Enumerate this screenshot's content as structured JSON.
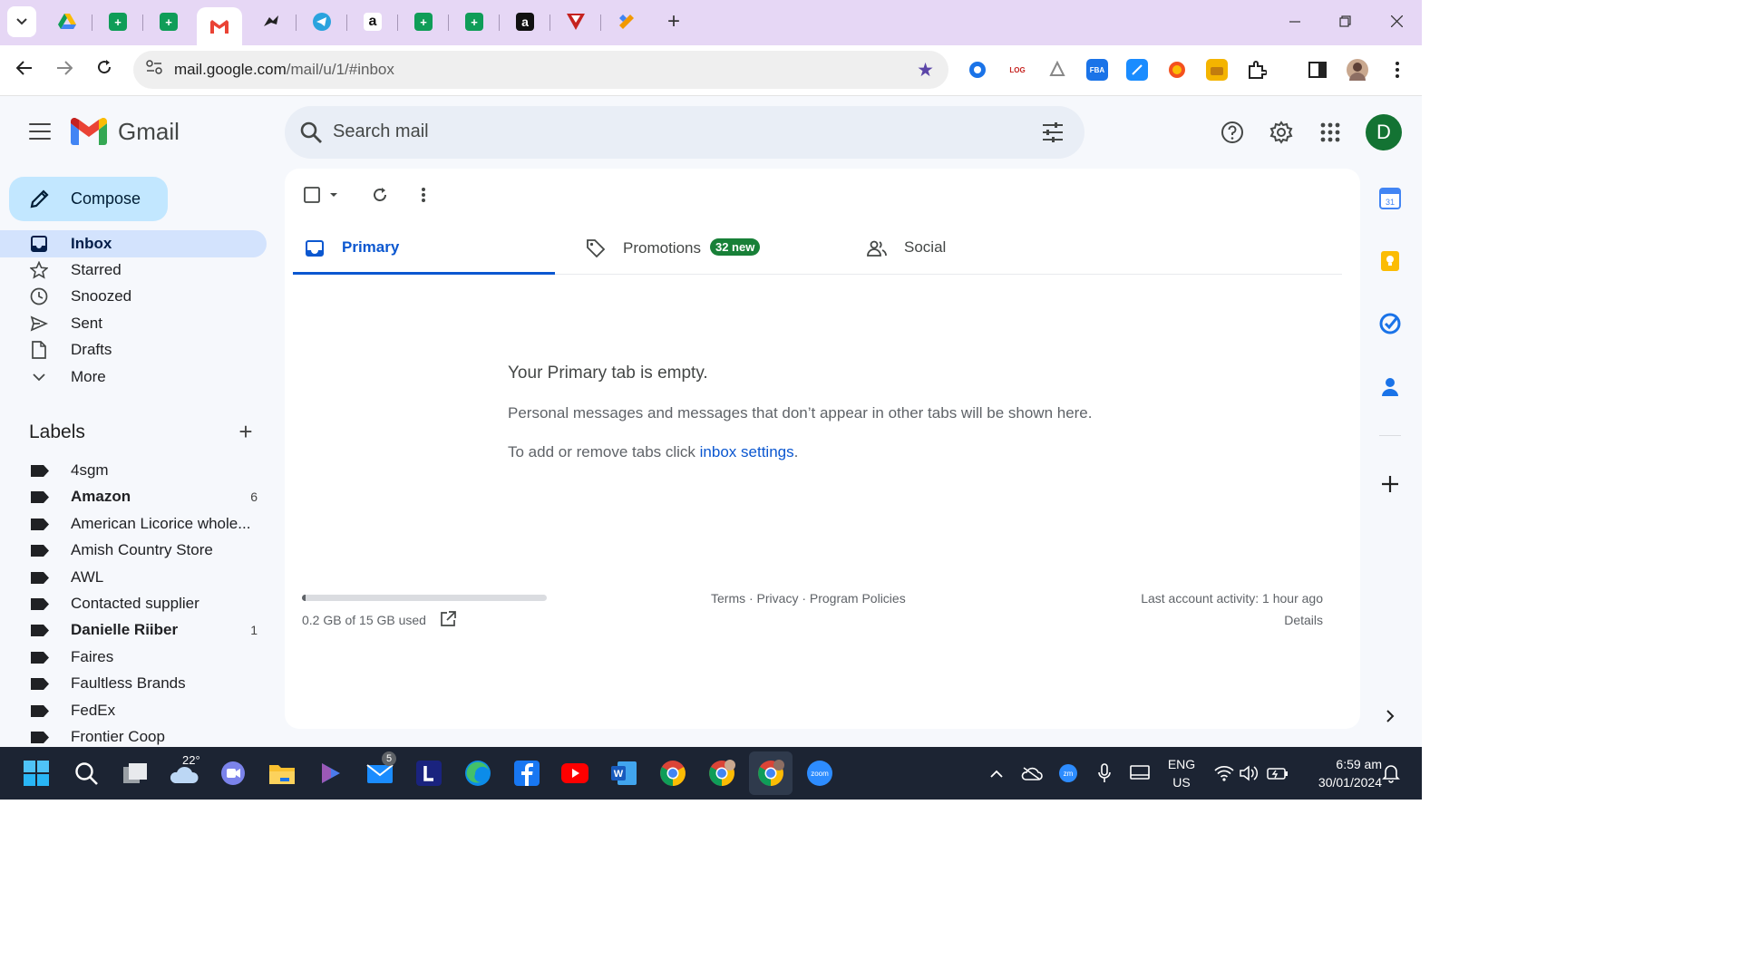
{
  "browser": {
    "tabs": [
      {
        "name": "google-drive",
        "color": "#fbbc04"
      },
      {
        "name": "google-sheets",
        "color": "#0f9d58"
      },
      {
        "name": "google-sheets",
        "color": "#0f9d58"
      },
      {
        "name": "gmail",
        "color": "#ea4335",
        "active": true
      },
      {
        "name": "blue-tool",
        "color": "#1a73e8"
      },
      {
        "name": "telegram",
        "color": "#2aa3de"
      },
      {
        "name": "amazon",
        "color": "#111111"
      },
      {
        "name": "google-sheets",
        "color": "#0f9d58"
      },
      {
        "name": "google-sheets",
        "color": "#0f9d58"
      },
      {
        "name": "amazon",
        "color": "#111111"
      },
      {
        "name": "red-extension",
        "color": "#c5221f"
      },
      {
        "name": "taskade",
        "color": "#f29900"
      }
    ],
    "url_host": "mail.google.com",
    "url_path": "/mail/u/1/#inbox"
  },
  "gmail": {
    "app_name": "Gmail",
    "search_placeholder": "Search mail",
    "avatar_letter": "D"
  },
  "nav": {
    "compose_label": "Compose",
    "items": [
      {
        "label": "Inbox",
        "icon": "inbox-icon",
        "active": true
      },
      {
        "label": "Starred",
        "icon": "star-icon"
      },
      {
        "label": "Snoozed",
        "icon": "clock-icon"
      },
      {
        "label": "Sent",
        "icon": "send-icon"
      },
      {
        "label": "Drafts",
        "icon": "draft-icon"
      },
      {
        "label": "More",
        "icon": "chevron-down-icon"
      }
    ]
  },
  "labels": {
    "title": "Labels",
    "items": [
      {
        "label": "4sgm",
        "bold": false,
        "count": ""
      },
      {
        "label": "Amazon",
        "bold": true,
        "count": "6"
      },
      {
        "label": "American Licorice whole...",
        "bold": false,
        "count": ""
      },
      {
        "label": "Amish Country Store",
        "bold": false,
        "count": ""
      },
      {
        "label": "AWL",
        "bold": false,
        "count": ""
      },
      {
        "label": "Contacted supplier",
        "bold": false,
        "count": ""
      },
      {
        "label": "Danielle Riiber",
        "bold": true,
        "count": "1"
      },
      {
        "label": "Faires",
        "bold": false,
        "count": ""
      },
      {
        "label": "Faultless Brands",
        "bold": false,
        "count": ""
      },
      {
        "label": "FedEx",
        "bold": false,
        "count": ""
      },
      {
        "label": "Frontier Coop",
        "bold": false,
        "count": ""
      }
    ]
  },
  "inbox": {
    "tabs": [
      {
        "label": "Primary",
        "icon": "inbox-icon",
        "active": true,
        "badge": ""
      },
      {
        "label": "Promotions",
        "icon": "tag-icon",
        "active": false,
        "badge": "32 new"
      },
      {
        "label": "Social",
        "icon": "people-icon",
        "active": false,
        "badge": ""
      }
    ],
    "empty_title": "Your Primary tab is empty.",
    "empty_message": "Personal messages and messages that don’t appear in other tabs will be shown here.",
    "settings_prefix": "To add or remove tabs click ",
    "settings_link": "inbox settings",
    "settings_suffix": "."
  },
  "footer": {
    "storage_used_fraction": 0.013,
    "storage_text": "0.2 GB of 15 GB used",
    "links": "Terms · Privacy · Program Policies",
    "last_activity": "Last account activity: 1 hour ago",
    "details": "Details"
  },
  "taskbar": {
    "weather_temp": "22°",
    "mail_badge": "5",
    "lang_line1": "ENG",
    "lang_line2": "US",
    "time": "6:59 am",
    "date": "30/01/2024"
  }
}
